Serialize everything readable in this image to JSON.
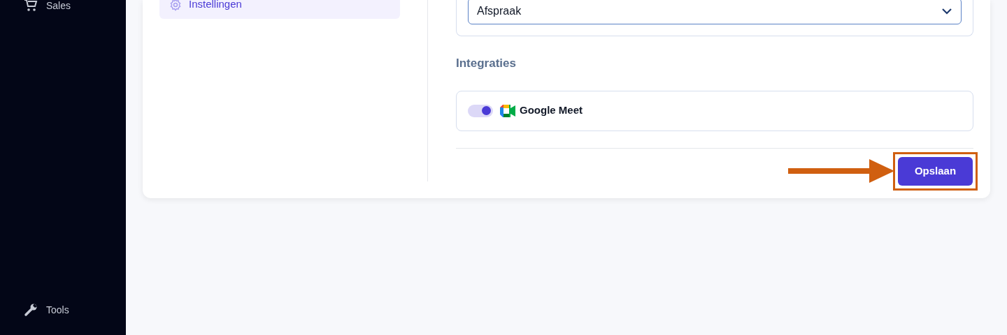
{
  "sidebar": {
    "items": [
      {
        "label": "Sales",
        "kind": "cart"
      }
    ],
    "footer_items": [
      {
        "label": "Tools",
        "kind": "wrench"
      }
    ]
  },
  "settings_nav": {
    "items": [
      {
        "label": "Instellingen",
        "selected": true
      }
    ]
  },
  "form": {
    "select": {
      "value": "Afspraak"
    },
    "integrations": {
      "heading": "Integraties",
      "items": [
        {
          "label": "Google Meet",
          "on": true
        }
      ]
    },
    "save_button": "Opslaan"
  }
}
